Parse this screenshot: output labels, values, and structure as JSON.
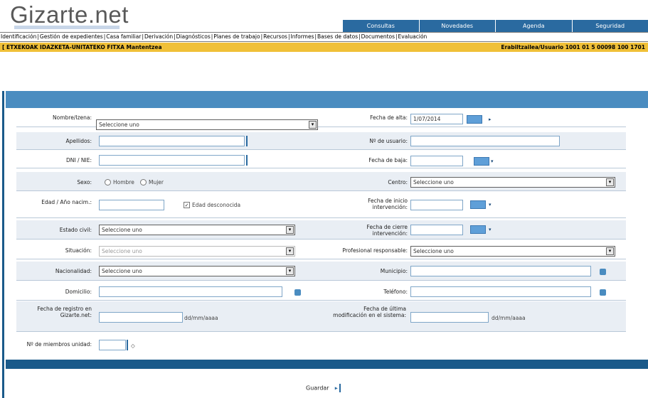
{
  "header": {
    "logo": "Gizarte.net",
    "nav_tabs": [
      "Consultas",
      "Novedades",
      "Agenda",
      "Seguridad"
    ]
  },
  "menubar": {
    "items": [
      "Identificación",
      "Gestión de expedientes",
      "Casa familiar",
      "Derivación",
      "Diagnósticos",
      "Planes de trabajo",
      "Recursos",
      "Informes",
      "Bases de datos",
      "Documentos",
      "Evaluación"
    ]
  },
  "patient_bar": {
    "left": "[ ETXEKOAK IDAZKETA-UNITATEKO FITXA  Mantentzea",
    "right": "Erabiltzailea/Usuario   1001 01 5 00098 100 1701"
  },
  "form": {
    "fields": {
      "c1": {
        "label": "Nombre/Izena:",
        "value": "Seleccione uno"
      },
      "c2": {
        "label": "Fecha de alta:",
        "value": "1/07/2014"
      },
      "c3": {
        "label": "Apellidos:",
        "value": ""
      },
      "c4": {
        "label": "Nº de usuario:",
        "value": ""
      },
      "c5": {
        "label": "DNI / NIE:",
        "value": ""
      },
      "c6": {
        "label": "Fecha de baja:",
        "value": ""
      },
      "c7": {
        "label": "Sexo:",
        "opt1": "Hombre",
        "opt2": "Mujer"
      },
      "c8": {
        "label": "Centro:",
        "value": "Seleccione uno"
      },
      "c9": {
        "label": "Edad / Año nacim.:",
        "value": "",
        "check": "Edad desconocida"
      },
      "c10": {
        "label": "Fecha de inicio intervención:",
        "value": ""
      },
      "c11": {
        "label": "Estado civil:",
        "value": "Seleccione uno"
      },
      "c12": {
        "label": "Fecha de cierre intervención:",
        "value": ""
      },
      "c13": {
        "label": "Situación:",
        "value": "Seleccione uno"
      },
      "c14": {
        "label": "Profesional responsable:",
        "value": "Seleccione uno"
      },
      "c15": {
        "label": "Nacionalidad:",
        "value": "Seleccione uno"
      },
      "c16": {
        "label": "Municipio:",
        "value": ""
      },
      "c17": {
        "label": "Domicilio:",
        "value": ""
      },
      "c18": {
        "label": "Teléfono:",
        "value": ""
      },
      "c19": {
        "label": "Fecha de registro en Gizarte.net:",
        "value": "",
        "hint": "dd/mm/aaaa"
      },
      "c20": {
        "label": "Fecha de última modificación en el sistema:",
        "value": "",
        "hint": "dd/mm/aaaa"
      },
      "c21": {
        "label": "Nº de miembros unidad:",
        "value": ""
      }
    }
  },
  "actions": {
    "save_label": "Guardar"
  }
}
